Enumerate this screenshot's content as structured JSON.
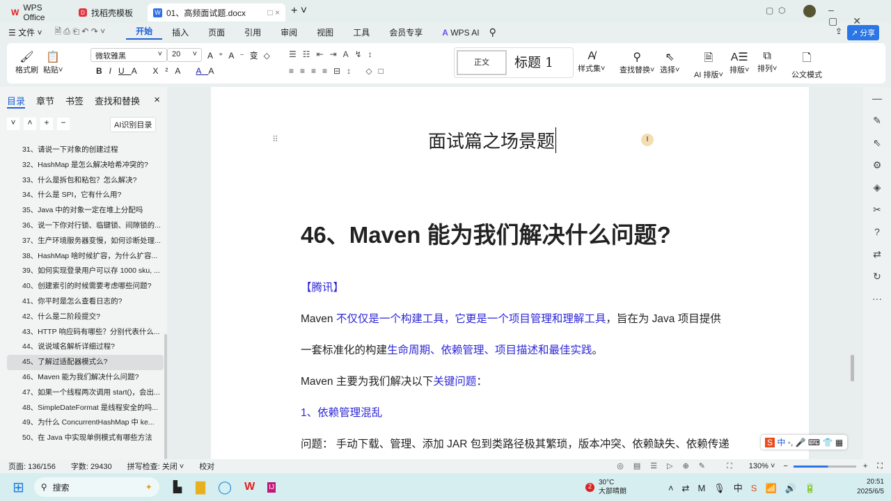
{
  "tabs": [
    {
      "label": "WPS Office"
    },
    {
      "label": "找稻壳模板"
    },
    {
      "label": "01、高频面试题.docx"
    }
  ],
  "menu": {
    "file": "文件",
    "items": [
      "开始",
      "插入",
      "页面",
      "引用",
      "审阅",
      "视图",
      "工具",
      "会员专享"
    ],
    "ai": "WPS AI",
    "share": "分享"
  },
  "ribbon": {
    "format_painter": "格式刷",
    "paste": "粘贴",
    "font": "微软雅黑",
    "size": "20",
    "style_normal": "正文",
    "style_h1": "标题 1",
    "style_set": "样式集",
    "find_replace": "查找替换",
    "select": "选择",
    "ai_layout": "AI 排版",
    "layout": "排版",
    "arrange": "排列",
    "official": "公文模式"
  },
  "sidebar": {
    "tabs": [
      "目录",
      "章节",
      "书签",
      "查找和替换"
    ],
    "ai_toc": "AI识别目录",
    "items": [
      "31、请说一下对象的创建过程",
      "32、HashMap 是怎么解决哈希冲突的?",
      "33、什么是拆包和粘包？怎么解决?",
      "34、什么是 SPI，它有什么用?",
      "35、Java 中的对象一定在堆上分配吗",
      "36、说一下你对行锁、临键锁、间隙锁的...",
      "37、生产环境服务器变慢，如何诊断处理...",
      "38、HashMap 啥时候扩容，为什么扩容...",
      "39、如何实现登录用户可以存 1000 sku, ...",
      "40、创建索引的时候需要考虑哪些问题?",
      "41、你平时是怎么查看日志的?",
      "42、什么是二阶段提交?",
      "43、HTTP 响应码有哪些？分别代表什么...",
      "44、说说域名解析详细过程?",
      "45、了解过适配器模式么?",
      "46、Maven 能为我们解决什么问题?",
      "47、如果一个线程两次调用 start()，会出...",
      "48、SimpleDateFormat 是线程安全的吗...",
      "49、为什么 ConcurrentHashMap 中 ke...",
      "50、在 Java 中实现单例模式有哪些方法"
    ]
  },
  "doc": {
    "section_title": "面试篇之场景题",
    "heading": "46、Maven 能为我们解决什么问题?",
    "tag": "【腾讯】",
    "p1a": "Maven ",
    "p1b": "不仅仅是一个构建工具，它更是一个项目管理和理解工具",
    "p1c": "，旨在为 Java 项目提供",
    "p2a": "一套标准化的构建",
    "p2b": "生命周期、依赖管理、项目描述和最佳实践",
    "p2c": "。",
    "p3a": "Maven 主要为我们解决以下",
    "p3b": "关键问题",
    "p3c": "：",
    "p4": "1、依赖管理混乱",
    "p5": "问题： 手动下载、管理、添加 JAR 包到类路径极其繁琐，版本冲突、依赖缺失、依赖传递"
  },
  "status": {
    "page": "页面: 136/156",
    "words": "字数: 29430",
    "spell": "拼写检查: 关闭",
    "proof": "校对",
    "zoom": "130%"
  },
  "taskbar": {
    "search": "搜索",
    "temp": "30°C",
    "weather": "大部晴朗",
    "badge": "2",
    "time": "20:51",
    "date": "2025/6/5"
  },
  "ime": {
    "lang": "中"
  }
}
